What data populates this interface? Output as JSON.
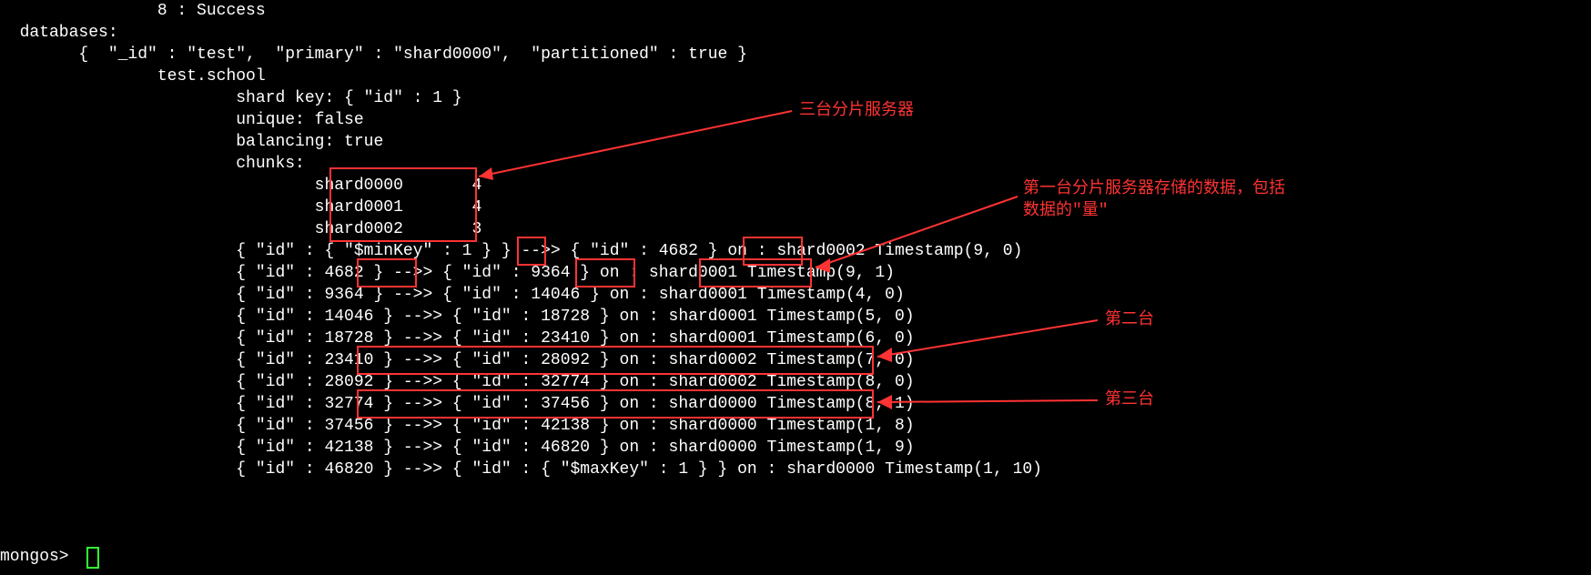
{
  "lines": {
    "l0": "                8 : Success",
    "l1": "  databases:",
    "l2": "        {  \"_id\" : \"test\",  \"primary\" : \"shard0000\",  \"partitioned\" : true }",
    "l3": "                test.school",
    "l4": "                        shard key: { \"id\" : 1 }",
    "l5": "                        unique: false",
    "l6": "                        balancing: true",
    "l7": "                        chunks:",
    "l8": "                                shard0000       4",
    "l9": "                                shard0001       4",
    "l10": "                                shard0002       3",
    "l11": "                        { \"id\" : { \"$minKey\" : 1 } } -->> { \"id\" : 4682 } on : shard0002 Timestamp(9, 0)",
    "l12": "                        { \"id\" : 4682 } -->> { \"id\" : 9364 } on : shard0001 Timestamp(9, 1)",
    "l13": "                        { \"id\" : 9364 } -->> { \"id\" : 14046 } on : shard0001 Timestamp(4, 0)",
    "l14": "                        { \"id\" : 14046 } -->> { \"id\" : 18728 } on : shard0001 Timestamp(5, 0)",
    "l15": "                        { \"id\" : 18728 } -->> { \"id\" : 23410 } on : shard0001 Timestamp(6, 0)",
    "l16": "                        { \"id\" : 23410 } -->> { \"id\" : 28092 } on : shard0002 Timestamp(7, 0)",
    "l17": "                        { \"id\" : 28092 } -->> { \"id\" : 32774 } on : shard0002 Timestamp(8, 0)",
    "l18": "                        { \"id\" : 32774 } -->> { \"id\" : 37456 } on : shard0000 Timestamp(8, 1)",
    "l19": "                        { \"id\" : 37456 } -->> { \"id\" : 42138 } on : shard0000 Timestamp(1, 8)",
    "l20": "                        { \"id\" : 42138 } -->> { \"id\" : 46820 } on : shard0000 Timestamp(1, 9)",
    "l21": "                        { \"id\" : 46820 } -->> { \"id\" : { \"$maxKey\" : 1 } } on : shard0000 Timestamp(1, 10)",
    "prompt": "mongos> "
  },
  "annotations": {
    "a1": "三台分片服务器",
    "a2_line1": "第一台分片服务器存储的数据，包括",
    "a2_line2": "数据的\"量\"",
    "a3": "第二台",
    "a4": "第三台"
  },
  "chunks_summary": {
    "shard0000": 4,
    "shard0001": 4,
    "shard0002": 3
  },
  "chunk_ranges": [
    {
      "min": "$minKey",
      "max": 4682,
      "shard": "shard0002",
      "ts": "9,0"
    },
    {
      "min": 4682,
      "max": 9364,
      "shard": "shard0001",
      "ts": "9,1"
    },
    {
      "min": 9364,
      "max": 14046,
      "shard": "shard0001",
      "ts": "4,0"
    },
    {
      "min": 14046,
      "max": 18728,
      "shard": "shard0001",
      "ts": "5,0"
    },
    {
      "min": 18728,
      "max": 23410,
      "shard": "shard0001",
      "ts": "6,0"
    },
    {
      "min": 23410,
      "max": 28092,
      "shard": "shard0002",
      "ts": "7,0"
    },
    {
      "min": 28092,
      "max": 32774,
      "shard": "shard0002",
      "ts": "8,0"
    },
    {
      "min": 32774,
      "max": 37456,
      "shard": "shard0000",
      "ts": "8,1"
    },
    {
      "min": 37456,
      "max": 42138,
      "shard": "shard0000",
      "ts": "1,8"
    },
    {
      "min": 42138,
      "max": 46820,
      "shard": "shard0000",
      "ts": "1,9"
    },
    {
      "min": 46820,
      "max": "$maxKey",
      "shard": "shard0000",
      "ts": "1,10"
    }
  ]
}
